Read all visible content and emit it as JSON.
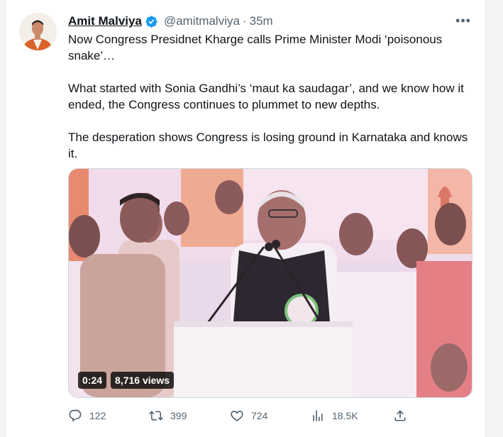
{
  "author": {
    "name": "Amit Malviya",
    "handle": "@amitmalviya",
    "separator": "·",
    "time": "35m",
    "verified": true
  },
  "more_label": "•••",
  "paragraphs": [
    "Now Congress Presidnet Kharge calls Prime Minister Modi ‘poisonous snake’…",
    "What started with Sonia Gandhi’s ‘maut ka saudagar’, and we know how it ended, the Congress continues to plummet to new depths.",
    "The desperation shows Congress is losing ground in Karnataka and knows it."
  ],
  "video": {
    "duration": "0:24",
    "views": "8,716 views"
  },
  "actions": {
    "replies": "122",
    "retweets": "399",
    "likes": "724",
    "views": "18.5K"
  },
  "colors": {
    "text": "#0f1419",
    "muted": "#536471",
    "verified": "#1d9bf0"
  }
}
